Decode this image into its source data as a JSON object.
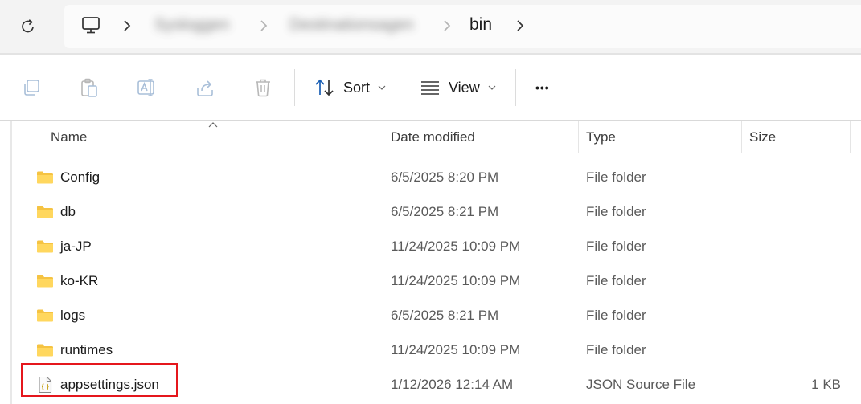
{
  "address_bar": {
    "crumbs_obscured": [
      "Sysloggen",
      "Destinationsagen"
    ],
    "current_folder": "bin"
  },
  "command_bar": {
    "sort_label": "Sort",
    "view_label": "View",
    "more_label": "•••"
  },
  "columns": {
    "name": "Name",
    "date_modified": "Date modified",
    "type": "Type",
    "size": "Size"
  },
  "files": [
    {
      "name": "Config",
      "date": "6/5/2025 8:20 PM",
      "type": "File folder",
      "size": "",
      "icon": "folder-icon"
    },
    {
      "name": "db",
      "date": "6/5/2025 8:21 PM",
      "type": "File folder",
      "size": "",
      "icon": "folder-icon"
    },
    {
      "name": "ja-JP",
      "date": "11/24/2025 10:09 PM",
      "type": "File folder",
      "size": "",
      "icon": "folder-icon"
    },
    {
      "name": "ko-KR",
      "date": "11/24/2025 10:09 PM",
      "type": "File folder",
      "size": "",
      "icon": "folder-icon"
    },
    {
      "name": "logs",
      "date": "6/5/2025 8:21 PM",
      "type": "File folder",
      "size": "",
      "icon": "folder-icon"
    },
    {
      "name": "runtimes",
      "date": "11/24/2025 10:09 PM",
      "type": "File folder",
      "size": "",
      "icon": "folder-icon"
    },
    {
      "name": "appsettings.json",
      "date": "1/12/2026 12:14 AM",
      "type": "JSON Source File",
      "size": "1 KB",
      "icon": "json-file-icon"
    }
  ],
  "colors": {
    "highlight": "#e5161c",
    "folder": "#f5c342",
    "accent": "#1a5fb4"
  }
}
